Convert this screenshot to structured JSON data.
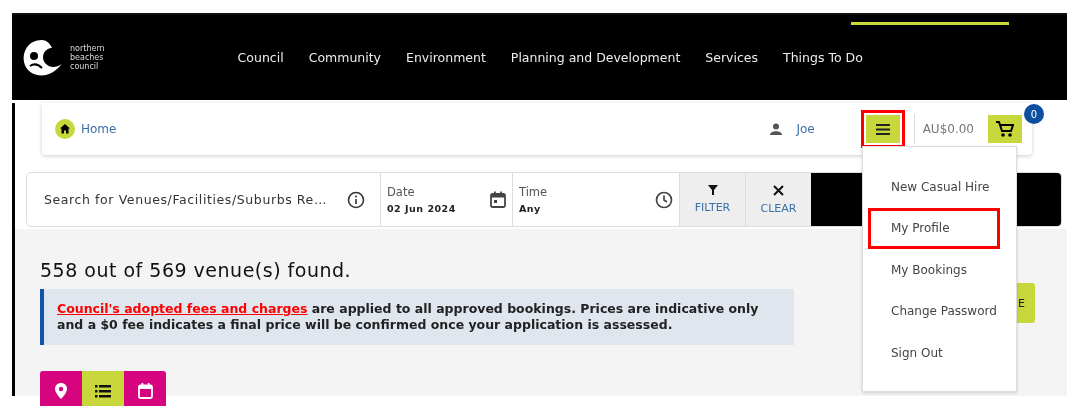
{
  "logo": {
    "lines": [
      "northern",
      "beaches",
      "council"
    ]
  },
  "nav": [
    {
      "label": "Council"
    },
    {
      "label": "Community"
    },
    {
      "label": "Environment"
    },
    {
      "label": "Planning and Development"
    },
    {
      "label": "Services"
    },
    {
      "label": "Things To Do"
    }
  ],
  "breadcrumb": {
    "label": "Home"
  },
  "user": {
    "name": "Joe"
  },
  "menu_button": {
    "highlighted": true
  },
  "cart": {
    "total": "AU$0.00",
    "count": "0"
  },
  "user_menu": [
    {
      "label": "New Casual Hire",
      "highlighted": false
    },
    {
      "label": "My Profile",
      "highlighted": true
    },
    {
      "label": "My Bookings",
      "highlighted": false
    },
    {
      "label": "Change Password",
      "highlighted": false
    },
    {
      "label": "Sign Out",
      "highlighted": false
    }
  ],
  "search": {
    "placeholder": "Search for Venues/Facilities/Suburbs Re…",
    "date_label": "Date",
    "date_value": "02 Jun 2024",
    "time_label": "Time",
    "time_value": "Any",
    "filter": "FILTER",
    "clear": "CLEAR"
  },
  "results": {
    "count": "558 out of 569 venue(s) found.",
    "notice_link": "Council's adopted fees and charges",
    "notice_text": " are applied to all approved bookings. Prices are indicative only and a $0 fee indicates a final price will be confirmed once your application is assessed.",
    "side_button": "E"
  },
  "views": [
    {
      "kind": "map",
      "selected": false
    },
    {
      "kind": "list",
      "selected": true
    },
    {
      "kind": "calendar",
      "selected": false
    }
  ]
}
